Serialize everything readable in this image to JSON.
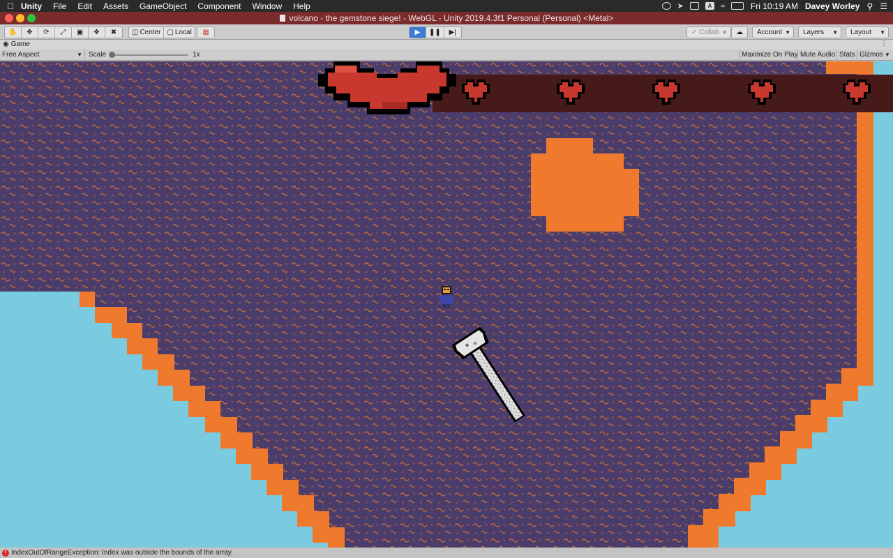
{
  "menubar": {
    "apple_icon": "apple-logo",
    "app_name": "Unity",
    "items": [
      "File",
      "Edit",
      "Assets",
      "GameObject",
      "Component",
      "Window",
      "Help"
    ],
    "clock": "Fri 10:19 AM",
    "user": "Davey Worley",
    "tray_icons": [
      "creative-cloud-icon",
      "send-icon",
      "airplay-icon",
      "text-input-icon",
      "wifi-icon",
      "battery-icon"
    ],
    "input_badge": "A"
  },
  "window": {
    "title": "volcano - the gemstone siege! - WebGL - Unity 2019.4.3f1 Personal (Personal) <Metal>"
  },
  "toolbar": {
    "tools": [
      "hand-icon",
      "move-icon",
      "rotate-icon",
      "scale-icon",
      "rect-icon",
      "transform-icon",
      "custom-tool-icon"
    ],
    "pivot_center": "Center",
    "pivot_local": "Local",
    "snap_icon": "grid-snap-icon",
    "play_icon": "play-icon",
    "pause_icon": "pause-icon",
    "step_icon": "step-icon",
    "collab": "Collab",
    "cloud_icon": "cloud-icon",
    "account": "Account",
    "layers": "Layers",
    "layout": "Layout"
  },
  "game_panel": {
    "tab": "Game",
    "aspect": "Free Aspect",
    "scale_label": "Scale",
    "scale_value": "1x",
    "scale_fraction": 0.0,
    "maximize": "Maximize On Play",
    "mute": "Mute Audio",
    "stats": "Stats",
    "gizmos": "Gizmos"
  },
  "game": {
    "hearts_filled": 6,
    "hearts_total": 6,
    "colors": {
      "sky": "#7bcbe0",
      "lava_rim": "#ef7a2e",
      "rock": "#4a3d6b",
      "squiggle": "#c06a3a",
      "heart": "#c8382e",
      "heart_bar": "#451a18"
    }
  },
  "status": {
    "error_icon": "error-icon",
    "message": "IndexOutOfRangeException: Index was outside the bounds of the array."
  }
}
